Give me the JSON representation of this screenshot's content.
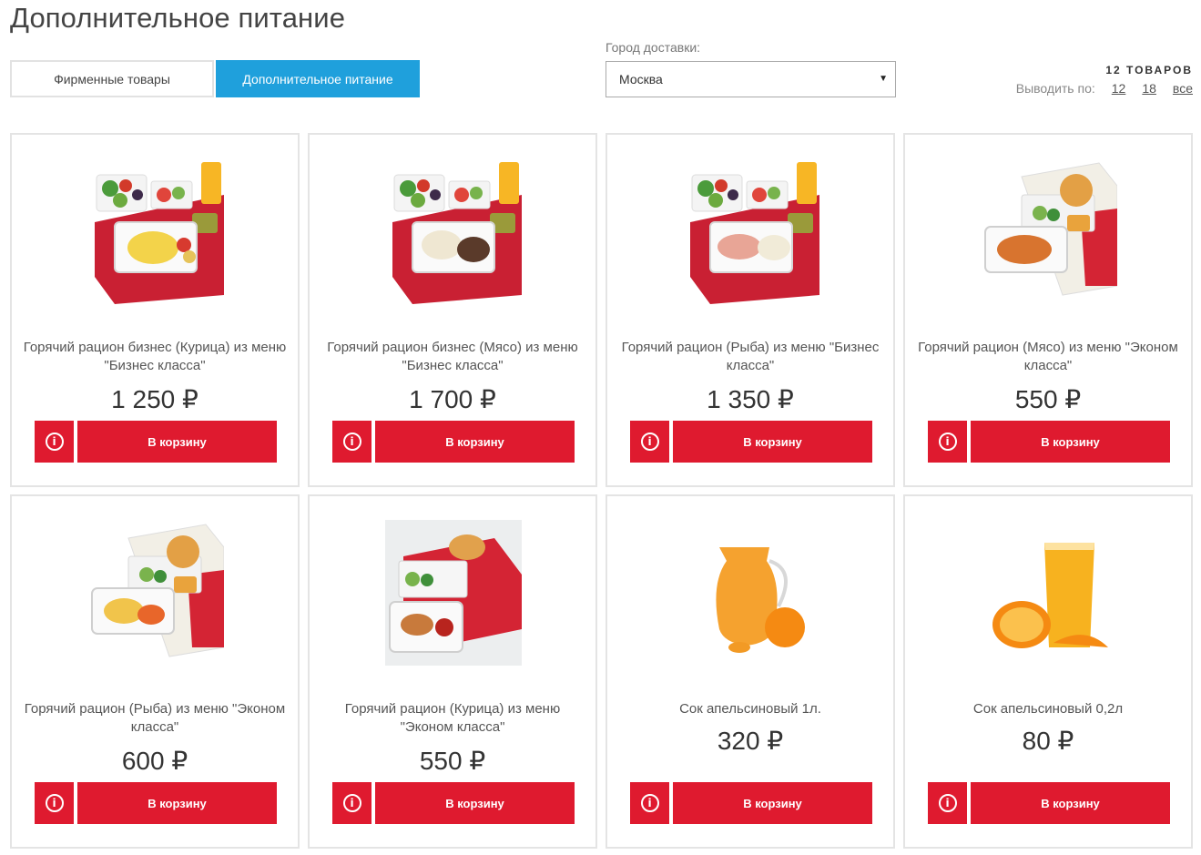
{
  "page": {
    "title": "Дополнительное питание"
  },
  "tabs": [
    {
      "label": "Фирменные товары",
      "active": false
    },
    {
      "label": "Дополнительное питание",
      "active": true
    }
  ],
  "city": {
    "label": "Город доставки:",
    "value": "Москва"
  },
  "listing": {
    "count": "12 ТОВАРОВ",
    "perpage_label": "Выводить по:",
    "perpage_options": [
      "12",
      "18",
      "все"
    ]
  },
  "products": [
    {
      "name": "Горячий рацион бизнес (Курица) из меню \"Бизнес класса\"",
      "price": "1 250 ₽",
      "cart_label": "В корзину",
      "image": "business-chicken-meal"
    },
    {
      "name": "Горячий рацион бизнес (Мясо) из меню \"Бизнес класса\"",
      "price": "1 700 ₽",
      "cart_label": "В корзину",
      "image": "business-meat-meal"
    },
    {
      "name": "Горячий рацион (Рыба) из меню \"Бизнес класса\"",
      "price": "1 350 ₽",
      "cart_label": "В корзину",
      "image": "business-fish-meal"
    },
    {
      "name": "Горячий рацион (Мясо) из меню \"Эконом класса\"",
      "price": "550 ₽",
      "cart_label": "В корзину",
      "image": "economy-meat-meal"
    },
    {
      "name": "Горячий рацион (Рыба) из меню \"Эконом класса\"",
      "price": "600 ₽",
      "cart_label": "В корзину",
      "image": "economy-fish-meal"
    },
    {
      "name": "Горячий рацион (Курица) из меню \"Эконом класса\"",
      "price": "550 ₽",
      "cart_label": "В корзину",
      "image": "economy-chicken-meal"
    },
    {
      "name": "Сок апельсиновый 1л.",
      "price": "320 ₽",
      "cart_label": "В корзину",
      "image": "orange-juice-jug"
    },
    {
      "name": "Сок апельсиновый 0,2л",
      "price": "80 ₽",
      "cart_label": "В корзину",
      "image": "orange-juice-glass"
    }
  ],
  "colors": {
    "accent_red": "#df1a2f",
    "tab_blue": "#1fa0dc"
  }
}
